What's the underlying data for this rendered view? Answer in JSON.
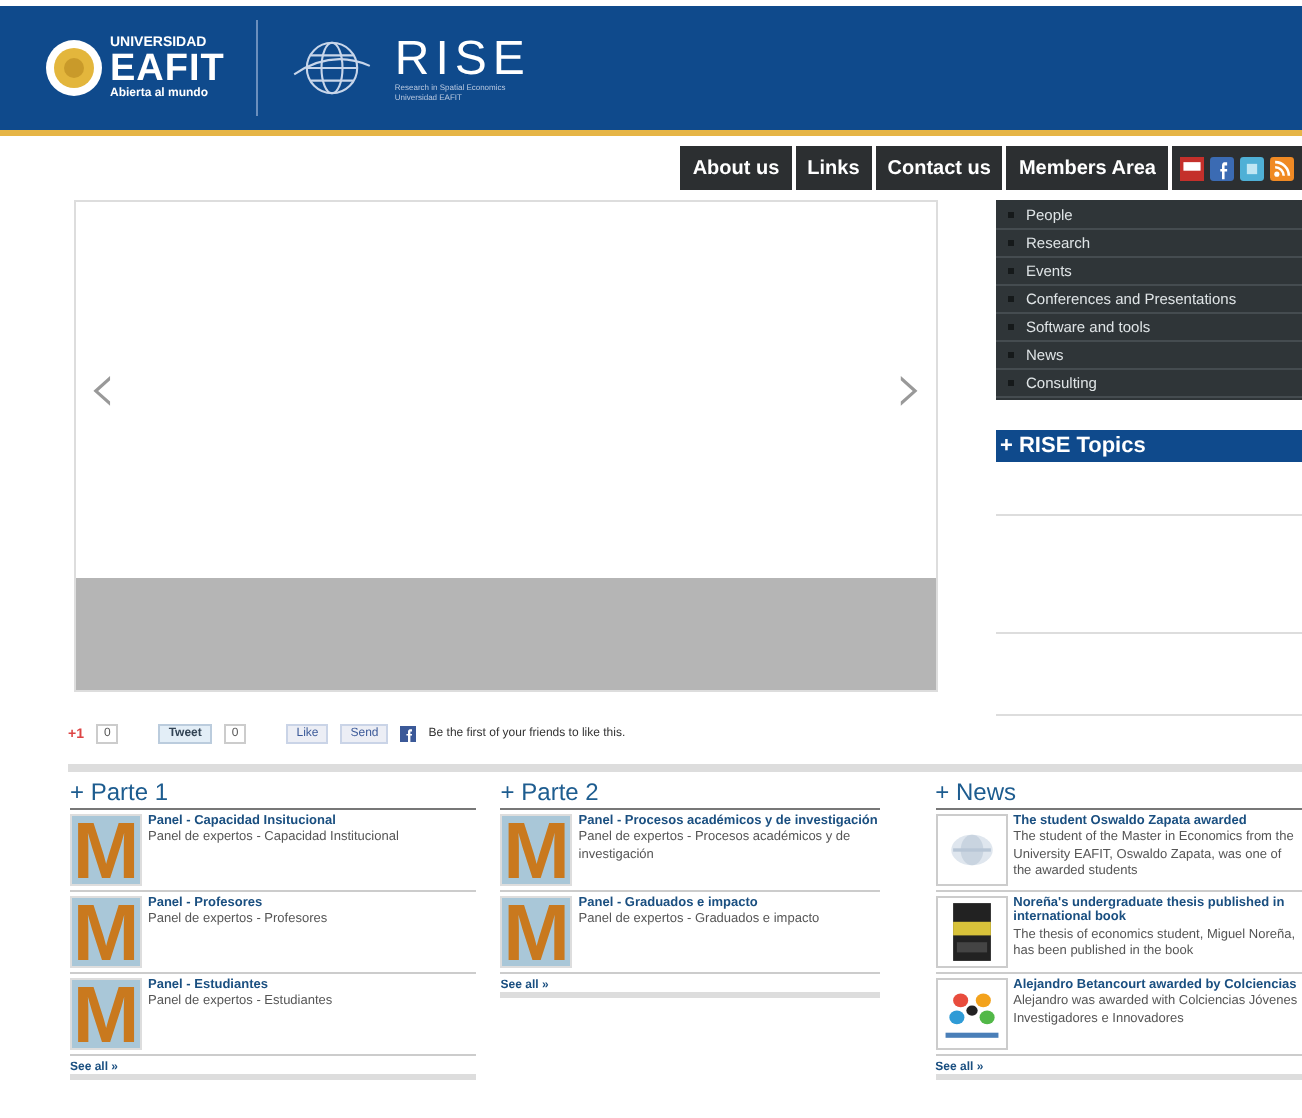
{
  "header": {
    "university": "UNIVERSIDAD",
    "logo": "EAFIT",
    "motto": "Abierta al mundo",
    "brand": "RISE",
    "brand_subtitle": "Research in Spatial Economics",
    "brand_university": "Universidad EAFIT"
  },
  "nav": [
    "About us",
    "Links",
    "Contact us",
    "Members Area"
  ],
  "social_icons": [
    {
      "kind": "youtube"
    },
    {
      "kind": "facebook"
    },
    {
      "kind": "twitter"
    },
    {
      "kind": "rss"
    }
  ],
  "slider": {
    "prev": "‹",
    "next": "›"
  },
  "side_menu": [
    "People",
    "Research",
    "Events",
    "Conferences and Presentations",
    "Software and tools",
    "News",
    "Consulting"
  ],
  "topics": {
    "title": "+ RISE Topics"
  },
  "share": {
    "plus_one": "+1",
    "plus_count": "0",
    "tweet": "Tweet",
    "tweet_count": "0",
    "like": "Like",
    "send": "Send",
    "facebook_text": "Be the first of your friends to like this."
  },
  "sections": [
    {
      "title": "+ Parte 1",
      "see_all": "See all »",
      "items": [
        {
          "thumb": "M",
          "title": "Panel - Capacidad Insitucional",
          "text": "Panel de expertos - Capacidad Institucional"
        },
        {
          "thumb": "M",
          "title": "Panel - Profesores",
          "text": "Panel de expertos - Profesores"
        },
        {
          "thumb": "M",
          "title": "Panel - Estudiantes",
          "text": "Panel de expertos - Estudiantes"
        }
      ]
    },
    {
      "title": "+ Parte 2",
      "see_all": "See all »",
      "items": [
        {
          "thumb": "M",
          "title": "Panel - Procesos académicos y de investigación",
          "text": "Panel de expertos - Procesos académicos y de investigación"
        },
        {
          "thumb": "M",
          "title": "Panel - Graduados e impacto",
          "text": "Panel de expertos - Graduados e impacto"
        }
      ]
    }
  ],
  "news": {
    "title": "+ News",
    "see_all": "See all »",
    "items": [
      {
        "kind": "picture",
        "title": "The student Oswaldo Zapata awarded",
        "text": "The student of the Master in Economics from the University EAFIT, Oswaldo Zapata, was one of the awarded students"
      },
      {
        "kind": "picture",
        "title": "Noreña's undergraduate thesis published in international book",
        "text": "The thesis of economics student, Miguel Noreña, has been published in the book"
      },
      {
        "kind": "picture",
        "title": "Alejandro Betancourt awarded by Colciencias",
        "text": "Alejandro was awarded with Colciencias Jóvenes Investigadores e Innovadores"
      }
    ]
  }
}
